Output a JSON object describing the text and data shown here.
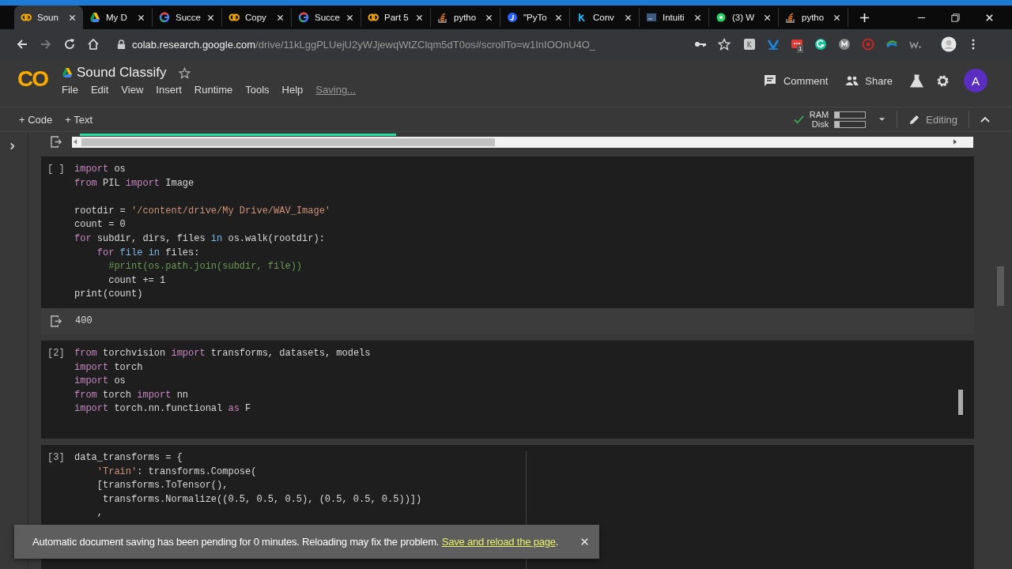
{
  "browser": {
    "tabs": [
      {
        "label": "Soun",
        "kind": "colab",
        "selected": true
      },
      {
        "label": "My D",
        "kind": "drive",
        "selected": false
      },
      {
        "label": "Succe",
        "kind": "google",
        "selected": false
      },
      {
        "label": "Copy",
        "kind": "colab",
        "selected": false
      },
      {
        "label": "Succe",
        "kind": "google",
        "selected": false
      },
      {
        "label": "Part 5",
        "kind": "colab",
        "selected": false
      },
      {
        "label": "pytho",
        "kind": "stack",
        "selected": false
      },
      {
        "label": "\"PyTo",
        "kind": "letter-j",
        "selected": false
      },
      {
        "label": "Conv",
        "kind": "letter-k",
        "selected": false
      },
      {
        "label": "Intuiti",
        "kind": "doc",
        "selected": false
      },
      {
        "label": "(3) W",
        "kind": "chat",
        "selected": false
      },
      {
        "label": "pytho",
        "kind": "stack",
        "selected": false
      }
    ],
    "url": {
      "host": "colab.research.google.com",
      "path": "/drive/11kLggPLUejU2yWJjewqWtZClqm5dT0os#scrollTo=w1InIOOnU4O_"
    },
    "extension_badge": "1"
  },
  "header": {
    "logo": "CO",
    "title": "Sound Classify",
    "menu": [
      "File",
      "Edit",
      "View",
      "Insert",
      "Runtime",
      "Tools",
      "Help"
    ],
    "save_status": "Saving...",
    "actions": [
      {
        "label": "Comment",
        "kind": "comment"
      },
      {
        "label": "Share",
        "kind": "share"
      }
    ],
    "avatar": "A"
  },
  "toolbar": {
    "insert": [
      "+ Code",
      "+ Text"
    ],
    "connected": true,
    "resources": [
      {
        "label": "RAM",
        "level": 0.15
      },
      {
        "label": "Disk",
        "level": 0.15
      }
    ],
    "mode": "Editing"
  },
  "cells": [
    {
      "count": "[ ]",
      "lines": [
        {
          "kind": "code",
          "tokens": [
            {
              "kind": "kw",
              "text": "import"
            },
            {
              "kind": "plain",
              "text": " os"
            }
          ]
        },
        {
          "kind": "code",
          "tokens": [
            {
              "kind": "kw",
              "text": "from"
            },
            {
              "kind": "plain",
              "text": " PIL "
            },
            {
              "kind": "kw",
              "text": "import"
            },
            {
              "kind": "plain",
              "text": " Image"
            }
          ]
        },
        {
          "kind": "blank"
        },
        {
          "kind": "code",
          "tokens": [
            {
              "kind": "plain",
              "text": "rootdir = "
            },
            {
              "kind": "str",
              "text": "'/content/drive/My Drive/WAV_Image'"
            }
          ]
        },
        {
          "kind": "code",
          "tokens": [
            {
              "kind": "plain",
              "text": "count = 0"
            }
          ]
        },
        {
          "kind": "code",
          "tokens": [
            {
              "kind": "kw",
              "text": "for"
            },
            {
              "kind": "plain",
              "text": " subdir, dirs, files "
            },
            {
              "kind": "op",
              "text": "in"
            },
            {
              "kind": "plain",
              "text": " os.walk(rootdir):"
            }
          ]
        },
        {
          "kind": "code",
          "tokens": [
            {
              "kind": "kw",
              "text": "    for"
            },
            {
              "kind": "op",
              "text": " file in"
            },
            {
              "kind": "plain",
              "text": " files:"
            }
          ]
        },
        {
          "kind": "code",
          "tokens": [
            {
              "kind": "com",
              "text": "      #print(os.path.join(subdir, file))"
            }
          ]
        },
        {
          "kind": "code",
          "tokens": [
            {
              "kind": "plain",
              "text": "      count += 1"
            }
          ]
        },
        {
          "kind": "code",
          "tokens": [
            {
              "kind": "plain",
              "text": "print(count)"
            }
          ]
        }
      ],
      "output": "400"
    },
    {
      "count": "[2]",
      "lines": [
        {
          "kind": "code",
          "tokens": [
            {
              "kind": "kw",
              "text": "from"
            },
            {
              "kind": "plain",
              "text": " torchvision "
            },
            {
              "kind": "kw",
              "text": "import"
            },
            {
              "kind": "plain",
              "text": " transforms, datasets, models"
            }
          ]
        },
        {
          "kind": "code",
          "tokens": [
            {
              "kind": "kw",
              "text": "import"
            },
            {
              "kind": "plain",
              "text": " torch"
            }
          ]
        },
        {
          "kind": "code",
          "tokens": [
            {
              "kind": "kw",
              "text": "import"
            },
            {
              "kind": "plain",
              "text": " os"
            }
          ]
        },
        {
          "kind": "code",
          "tokens": [
            {
              "kind": "kw",
              "text": "from"
            },
            {
              "kind": "plain",
              "text": " torch "
            },
            {
              "kind": "kw",
              "text": "import"
            },
            {
              "kind": "plain",
              "text": " nn"
            }
          ]
        },
        {
          "kind": "code",
          "tokens": [
            {
              "kind": "kw",
              "text": "import"
            },
            {
              "kind": "plain",
              "text": " torch.nn.functional "
            },
            {
              "kind": "kw",
              "text": "as"
            },
            {
              "kind": "plain",
              "text": " F"
            }
          ]
        }
      ]
    },
    {
      "count": "[3]",
      "lines": [
        {
          "kind": "code",
          "tokens": [
            {
              "kind": "plain",
              "text": "data_transforms = {"
            }
          ]
        },
        {
          "kind": "code",
          "tokens": [
            {
              "kind": "str",
              "text": "    'Train'"
            },
            {
              "kind": "plain",
              "text": ": transforms.Compose("
            }
          ]
        },
        {
          "kind": "code",
          "tokens": [
            {
              "kind": "plain",
              "text": "    [transforms.ToTensor(),"
            }
          ]
        },
        {
          "kind": "code",
          "tokens": [
            {
              "kind": "plain",
              "text": "     transforms.Normalize((0.5, 0.5, 0.5), (0.5, 0.5, 0.5))])"
            }
          ]
        },
        {
          "kind": "code",
          "tokens": [
            {
              "kind": "plain",
              "text": "    ,"
            }
          ]
        }
      ]
    }
  ],
  "toast": {
    "message": "Automatic document saving has been pending for 0 minutes. Reloading may fix the problem.",
    "link": "Save and reload the page",
    "tail": "."
  }
}
